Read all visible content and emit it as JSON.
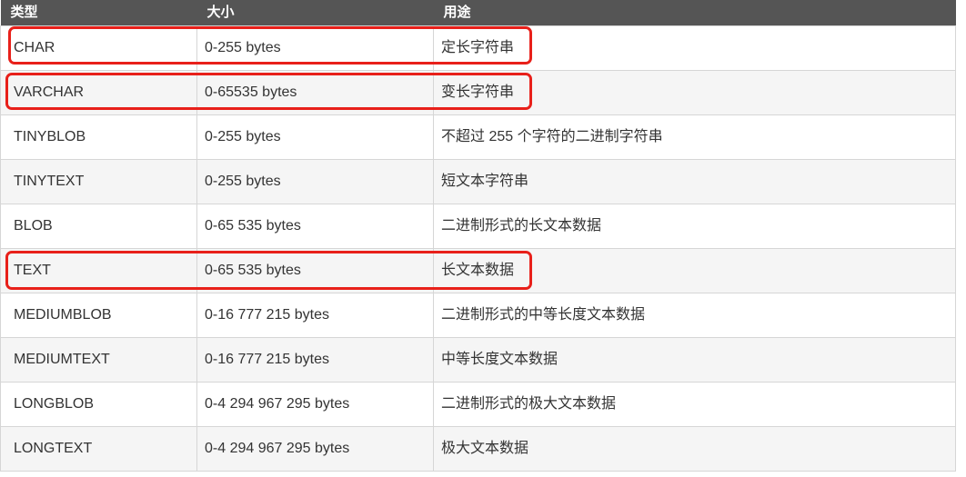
{
  "table": {
    "headers": [
      "类型",
      "大小",
      "用途"
    ],
    "rows": [
      [
        "CHAR",
        "0-255 bytes",
        "定长字符串"
      ],
      [
        "VARCHAR",
        "0-65535 bytes",
        "变长字符串"
      ],
      [
        "TINYBLOB",
        "0-255 bytes",
        "不超过 255 个字符的二进制字符串"
      ],
      [
        "TINYTEXT",
        "0-255 bytes",
        "短文本字符串"
      ],
      [
        "BLOB",
        "0-65 535 bytes",
        "二进制形式的长文本数据"
      ],
      [
        "TEXT",
        "0-65 535 bytes",
        "长文本数据"
      ],
      [
        "MEDIUMBLOB",
        "0-16 777 215 bytes",
        "二进制形式的中等长度文本数据"
      ],
      [
        "MEDIUMTEXT",
        "0-16 777 215 bytes",
        "中等长度文本数据"
      ],
      [
        "LONGBLOB",
        "0-4 294 967 295 bytes",
        "二进制形式的极大文本数据"
      ],
      [
        "LONGTEXT",
        "0-4 294 967 295 bytes",
        "极大文本数据"
      ]
    ],
    "highlighted_rows": [
      "CHAR",
      "VARCHAR",
      "TEXT"
    ]
  },
  "colors": {
    "header_background": "#555555",
    "header_text": "#ffffff",
    "highlight_border": "#e8201a",
    "stripe_background": "#f5f5f5"
  }
}
